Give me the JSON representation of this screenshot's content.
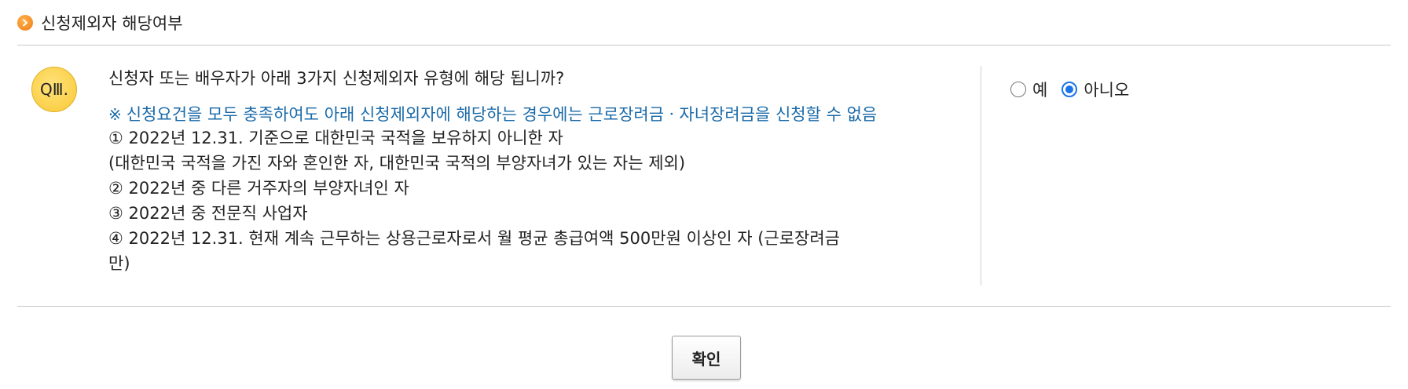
{
  "section": {
    "title": "신청제외자 해당여부"
  },
  "question": {
    "badge": "QⅢ.",
    "text": "신청자 또는 배우자가 아래 3가지 신청제외자 유형에 해당 됩니까?",
    "notice_mark": "※",
    "notice": "신청요건을 모두 충족하여도 아래 신청제외자에 해당하는 경우에는 근로장려금ㆍ자녀장려금을 신청할 수 없음",
    "items": [
      "① 2022년 12.31. 기준으로 대한민국 국적을 보유하지 아니한 자",
      "(대한민국 국적을 가진 자와 혼인한 자, 대한민국 국적의 부양자녀가 있는 자는 제외)",
      "② 2022년 중 다른 거주자의 부양자녀인 자",
      "③ 2022년 중 전문직 사업자",
      "④ 2022년 12.31. 현재 계속 근무하는 상용근로자로서 월 평균 총급여액 500만원 이상인 자 (근로장려금",
      "만)"
    ]
  },
  "options": {
    "yes": "예",
    "no": "아니오",
    "selected": "no"
  },
  "confirm": {
    "label": "확인"
  },
  "colors": {
    "accent": "#1a73e8",
    "notice": "#1a6aa8",
    "badge": "#f9c935",
    "bullet": "#f07a12"
  }
}
